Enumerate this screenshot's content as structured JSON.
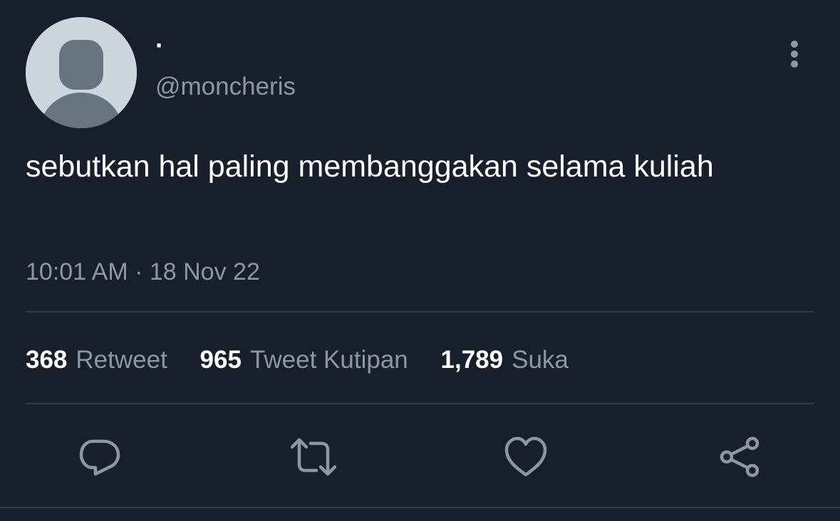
{
  "author": {
    "display_name": "·",
    "handle": "@moncheris",
    "avatar": "default-profile-silhouette"
  },
  "tweet": {
    "text": "sebutkan hal paling membanggakan selama kuliah",
    "timestamp": "10:01 AM · 18 Nov 22"
  },
  "stats": [
    {
      "count": "368",
      "label": "Retweet"
    },
    {
      "count": "965",
      "label": "Tweet Kutipan"
    },
    {
      "count": "1,789",
      "label": "Suka"
    }
  ],
  "actions": [
    "reply-icon",
    "retweet-icon",
    "like-icon",
    "share-icon"
  ],
  "colors": {
    "background": "#161f2a",
    "secondary_text": "#8899a6",
    "divider": "#2f3b47",
    "avatar_bg": "#ccd6dd",
    "avatar_figure": "#66757f"
  }
}
